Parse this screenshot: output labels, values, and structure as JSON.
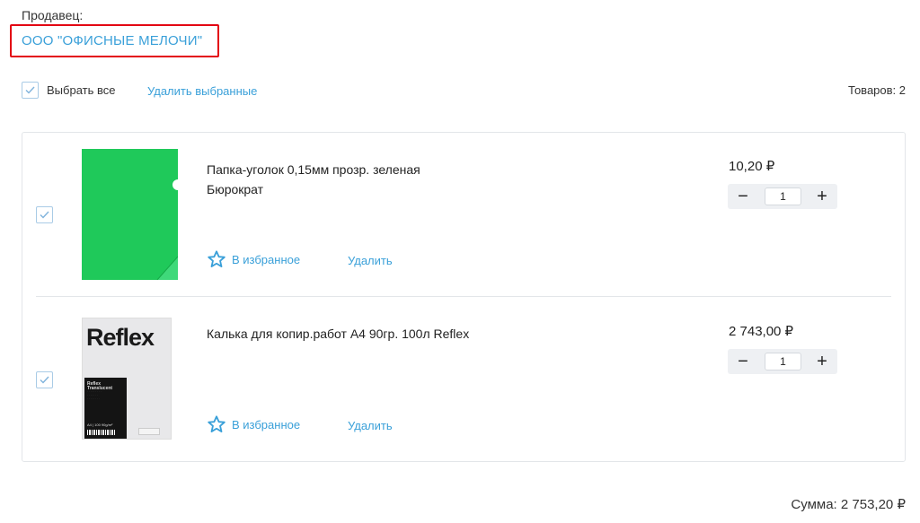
{
  "seller": {
    "label": "Продавец:",
    "name": "ООО \"ОФИСНЫЕ МЕЛОЧИ\""
  },
  "toolbar": {
    "select_all": "Выбрать все",
    "delete_selected": "Удалить выбранные",
    "items_count": "Товаров: 2"
  },
  "items": [
    {
      "title_line1": "Папка-уголок 0,15мм прозр. зеленая",
      "title_line2": "Бюрократ",
      "favorite": "В избранное",
      "remove": "Удалить",
      "price": "10,20 ₽",
      "qty_minus": "−",
      "qty_value": "1",
      "qty_plus": "+",
      "checked": true
    },
    {
      "title_line1": "Калька для копир.работ А4 90гр. 100л Reflex",
      "favorite": "В избранное",
      "remove": "Удалить",
      "price": "2 743,00 ₽",
      "qty_minus": "−",
      "qty_value": "1",
      "qty_plus": "+",
      "checked": true,
      "thumb": {
        "logo": "Reflex",
        "line1": "Reflex",
        "line2": "Translucent",
        "size": "A4 | 100    90g/m²"
      }
    }
  ],
  "total": "Сумма: 2 753,20 ₽",
  "colors": {
    "accent": "#3aa0d9",
    "highlight_box": "#e30613",
    "folder_green": "#1fc95a"
  },
  "icons": {
    "checkbox": "check-icon",
    "favorite": "star-outline-icon"
  }
}
